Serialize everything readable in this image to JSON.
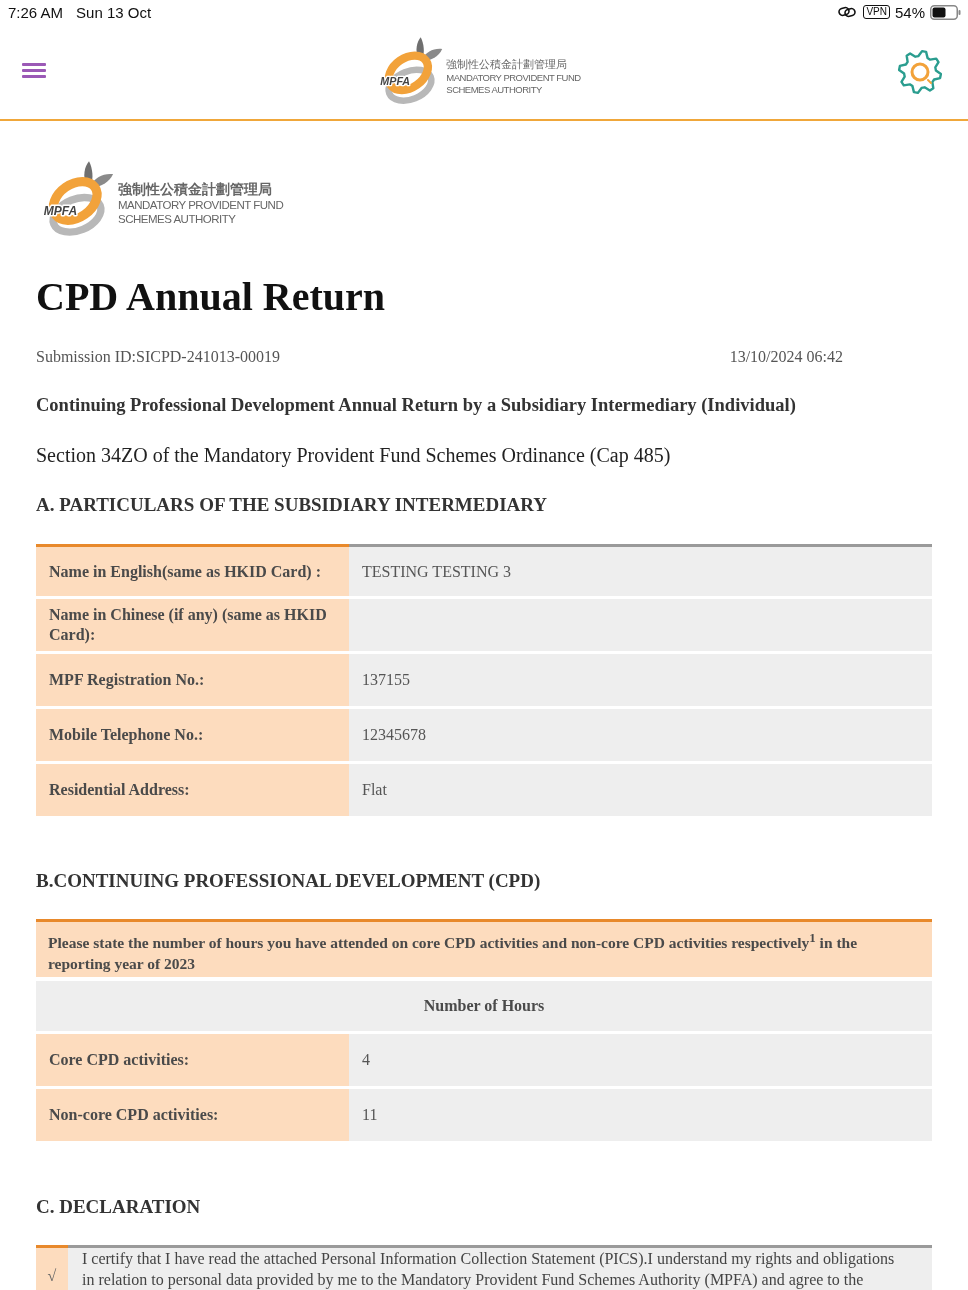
{
  "status_bar": {
    "time": "7:26 AM",
    "date": "Sun 13 Oct",
    "vpn": "VPN",
    "battery": "54%"
  },
  "header": {
    "logo": {
      "lettering": "MPFA",
      "chinese_name": "強制性公積金計劃管理局",
      "english_name": [
        "MANDATORY PROVIDENT FUND",
        "SCHEMES AUTHORITY"
      ]
    }
  },
  "document": {
    "logo": {
      "lettering": "MPFA",
      "chinese_name": "強制性公積金計劃管理局",
      "english_name": [
        "MANDATORY PROVIDENT FUND",
        "SCHEMES AUTHORITY"
      ]
    },
    "title": "CPD Annual Return",
    "submission_id": "Submission ID:SICPD-241013-00019",
    "submitted_at": "13/10/2024 06:42",
    "heading": "Continuing Professional Development Annual Return by a Subsidiary Intermediary (Individual)",
    "ordinance": "Section 34ZO of the Mandatory Provident Fund Schemes Ordinance (Cap 485)"
  },
  "section_a": {
    "title": "A. PARTICULARS OF THE SUBSIDIARY INTERMEDIARY",
    "rows": [
      {
        "label": "Name in English(same as HKID Card) :",
        "value": "TESTING TESTING 3"
      },
      {
        "label": "Name in Chinese (if any) (same as HKID Card):"
      },
      {
        "label": "MPF Registration No.:",
        "value": "137155"
      },
      {
        "label": "Mobile Telephone No.:",
        "value": "12345678"
      },
      {
        "label": "Residential Address:",
        "value": "Flat"
      }
    ]
  },
  "section_b": {
    "title": "B.CONTINUING PROFESSIONAL DEVELOPMENT (CPD)",
    "instruction": "Please state the number of hours you have attended on core CPD activities and non-core CPD activities respectively$^{1}$ in the reporting year of 2023",
    "column_heading": "Number of Hours",
    "rows": [
      {
        "label": "Core CPD activities:",
        "value": "4"
      },
      {
        "label": "Non-core CPD activities:",
        "value": "11"
      }
    ]
  },
  "section_c": {
    "title": "C. DECLARATION",
    "items": [
      {
        "mark": "√",
        "text": "I certify that I have read the attached Personal Information Collection Statement (PICS).I understand my rights and obligations in relation to personal data provided by me to the Mandatory Provident Fund Schemes Authority (MPFA) and agree to the"
      }
    ]
  }
}
